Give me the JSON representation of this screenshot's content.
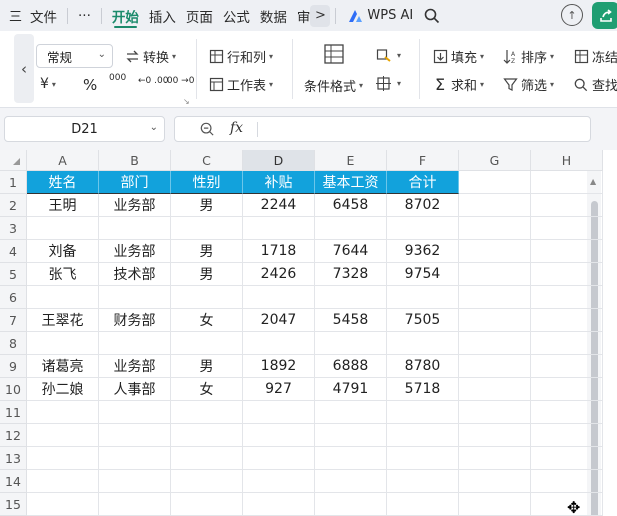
{
  "menubar": {
    "hamburger": "三",
    "file": "文件",
    "more": "···",
    "tabs": [
      "开始",
      "插入",
      "页面",
      "公式",
      "数据",
      "审"
    ],
    "active_tab": "开始",
    "chevron": ">",
    "wps_ai": "WPS AI",
    "accent": "#1a8a6b"
  },
  "ribbon": {
    "font": "常规",
    "convert": "转换",
    "row_col": "行和列",
    "worksheet": "工作表",
    "cond_format": "条件格式",
    "fill": "填充",
    "sort": "排序",
    "freeze": "冻结",
    "sum": "求和",
    "filter": "筛选",
    "find": "查找",
    "currency": "¥",
    "percent": "%",
    "thousands": "000",
    "dec_inc": "←0 .00",
    "dec_dec": ".00 →0"
  },
  "formula_bar": {
    "name_box": "D21",
    "fx": "fx",
    "formula": ""
  },
  "sheet": {
    "columns": [
      "A",
      "B",
      "C",
      "D",
      "E",
      "F",
      "G",
      "H"
    ],
    "selected_column": "D",
    "row_numbers": [
      "1",
      "2",
      "3",
      "4",
      "5",
      "6",
      "7",
      "8",
      "9",
      "10",
      "11",
      "12",
      "13",
      "14",
      "15"
    ],
    "header_row": [
      "姓名",
      "部门",
      "性别",
      "补贴",
      "基本工资",
      "合计"
    ],
    "header_color": "#12a2dc",
    "rows": [
      [
        "王明",
        "业务部",
        "男",
        "2244",
        "6458",
        "8702"
      ],
      [
        "",
        "",
        "",
        "",
        "",
        ""
      ],
      [
        "刘备",
        "业务部",
        "男",
        "1718",
        "7644",
        "9362"
      ],
      [
        "张飞",
        "技术部",
        "男",
        "2426",
        "7328",
        "9754"
      ],
      [
        "",
        "",
        "",
        "",
        "",
        ""
      ],
      [
        "王翠花",
        "财务部",
        "女",
        "2047",
        "5458",
        "7505"
      ],
      [
        "",
        "",
        "",
        "",
        "",
        ""
      ],
      [
        "诸葛亮",
        "业务部",
        "男",
        "1892",
        "6888",
        "8780"
      ],
      [
        "孙二娘",
        "人事部",
        "女",
        "927",
        "4791",
        "5718"
      ]
    ]
  }
}
